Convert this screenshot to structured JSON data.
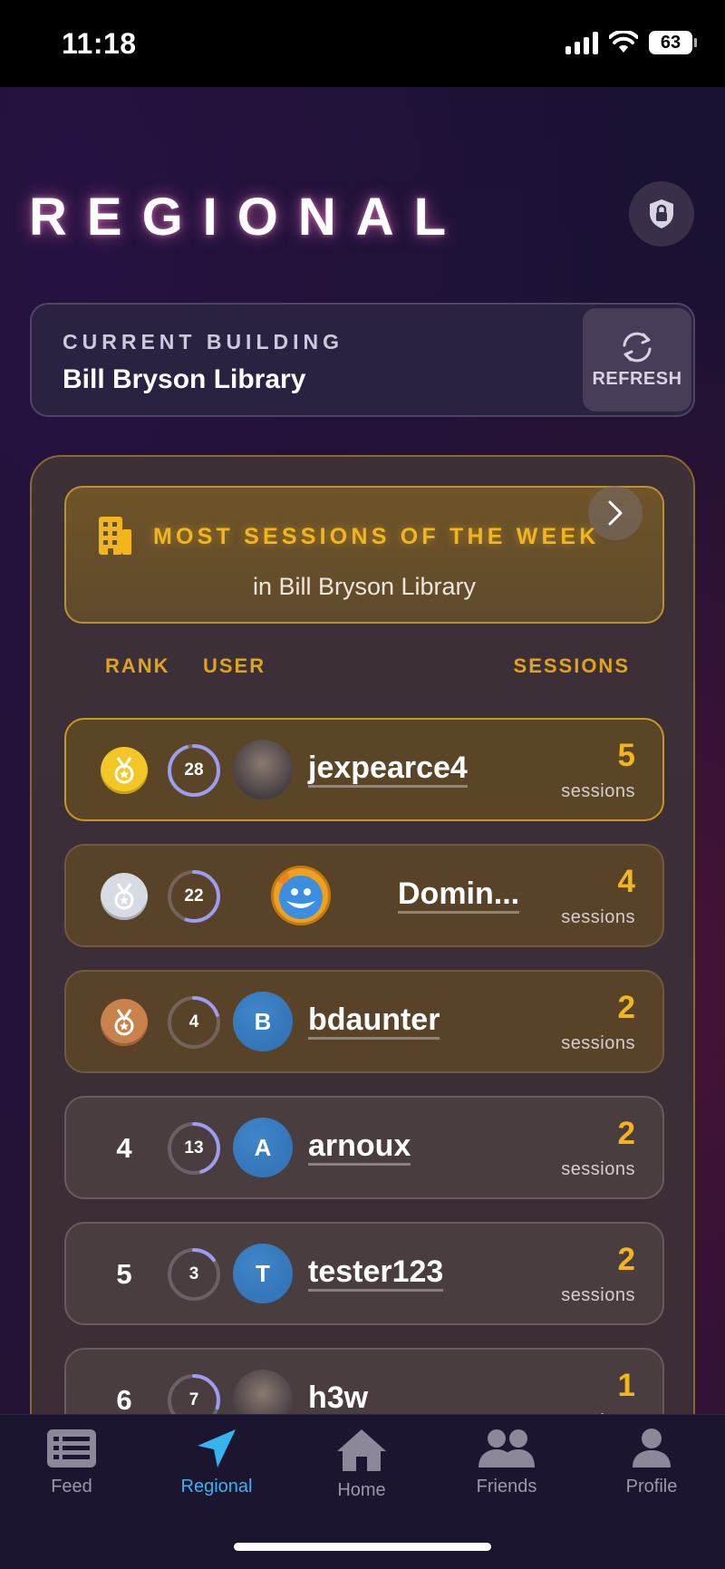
{
  "status_bar": {
    "time": "11:18",
    "battery": "63"
  },
  "header": {
    "title": "REGIONAL",
    "lock_icon": "lock-shield-icon"
  },
  "building": {
    "label": "CURRENT BUILDING",
    "name": "Bill Bryson Library",
    "refresh_label": "REFRESH"
  },
  "leaderboard": {
    "title": "MOST SESSIONS OF THE WEEK",
    "subtitle": "in Bill Bryson Library",
    "columns": {
      "rank": "RANK",
      "user": "USER",
      "sessions": "SESSIONS"
    },
    "sessions_unit": "sessions",
    "rows": [
      {
        "rank": "1",
        "medal": "gold",
        "level": "28",
        "level_progress": 0.95,
        "avatar_letter": "",
        "avatar_color": "#4a5a78",
        "username": "jexpearce4",
        "sessions": "5"
      },
      {
        "rank": "2",
        "medal": "silver",
        "level": "22",
        "level_progress": 0.55,
        "avatar_letter": "",
        "avatar_color": "#f0a020",
        "username": "Domin...",
        "sessions": "4"
      },
      {
        "rank": "3",
        "medal": "bronze",
        "level": "4",
        "level_progress": 0.2,
        "avatar_letter": "B",
        "avatar_color": "#2f6fb2",
        "username": "bdaunter",
        "sessions": "2"
      },
      {
        "rank": "4",
        "medal": "",
        "level": "13",
        "level_progress": 0.45,
        "avatar_letter": "A",
        "avatar_color": "#2f6fb2",
        "username": "arnoux",
        "sessions": "2"
      },
      {
        "rank": "5",
        "medal": "",
        "level": "3",
        "level_progress": 0.15,
        "avatar_letter": "T",
        "avatar_color": "#2f6fb2",
        "username": "tester123",
        "sessions": "2"
      },
      {
        "rank": "6",
        "medal": "",
        "level": "7",
        "level_progress": 0.3,
        "avatar_letter": "",
        "avatar_color": "#5a4030",
        "username": "h3w",
        "sessions": "1"
      }
    ]
  },
  "tabs": [
    {
      "label": "Feed",
      "icon": "newspaper-icon",
      "active": false
    },
    {
      "label": "Regional",
      "icon": "location-arrow-icon",
      "active": true
    },
    {
      "label": "Home",
      "icon": "home-icon",
      "active": false
    },
    {
      "label": "Friends",
      "icon": "friends-icon",
      "active": false
    },
    {
      "label": "Profile",
      "icon": "profile-icon",
      "active": false
    }
  ],
  "colors": {
    "accent": "#f2b51c",
    "active_tab": "#36b4f0",
    "level_ring": "#9c9cf0"
  }
}
